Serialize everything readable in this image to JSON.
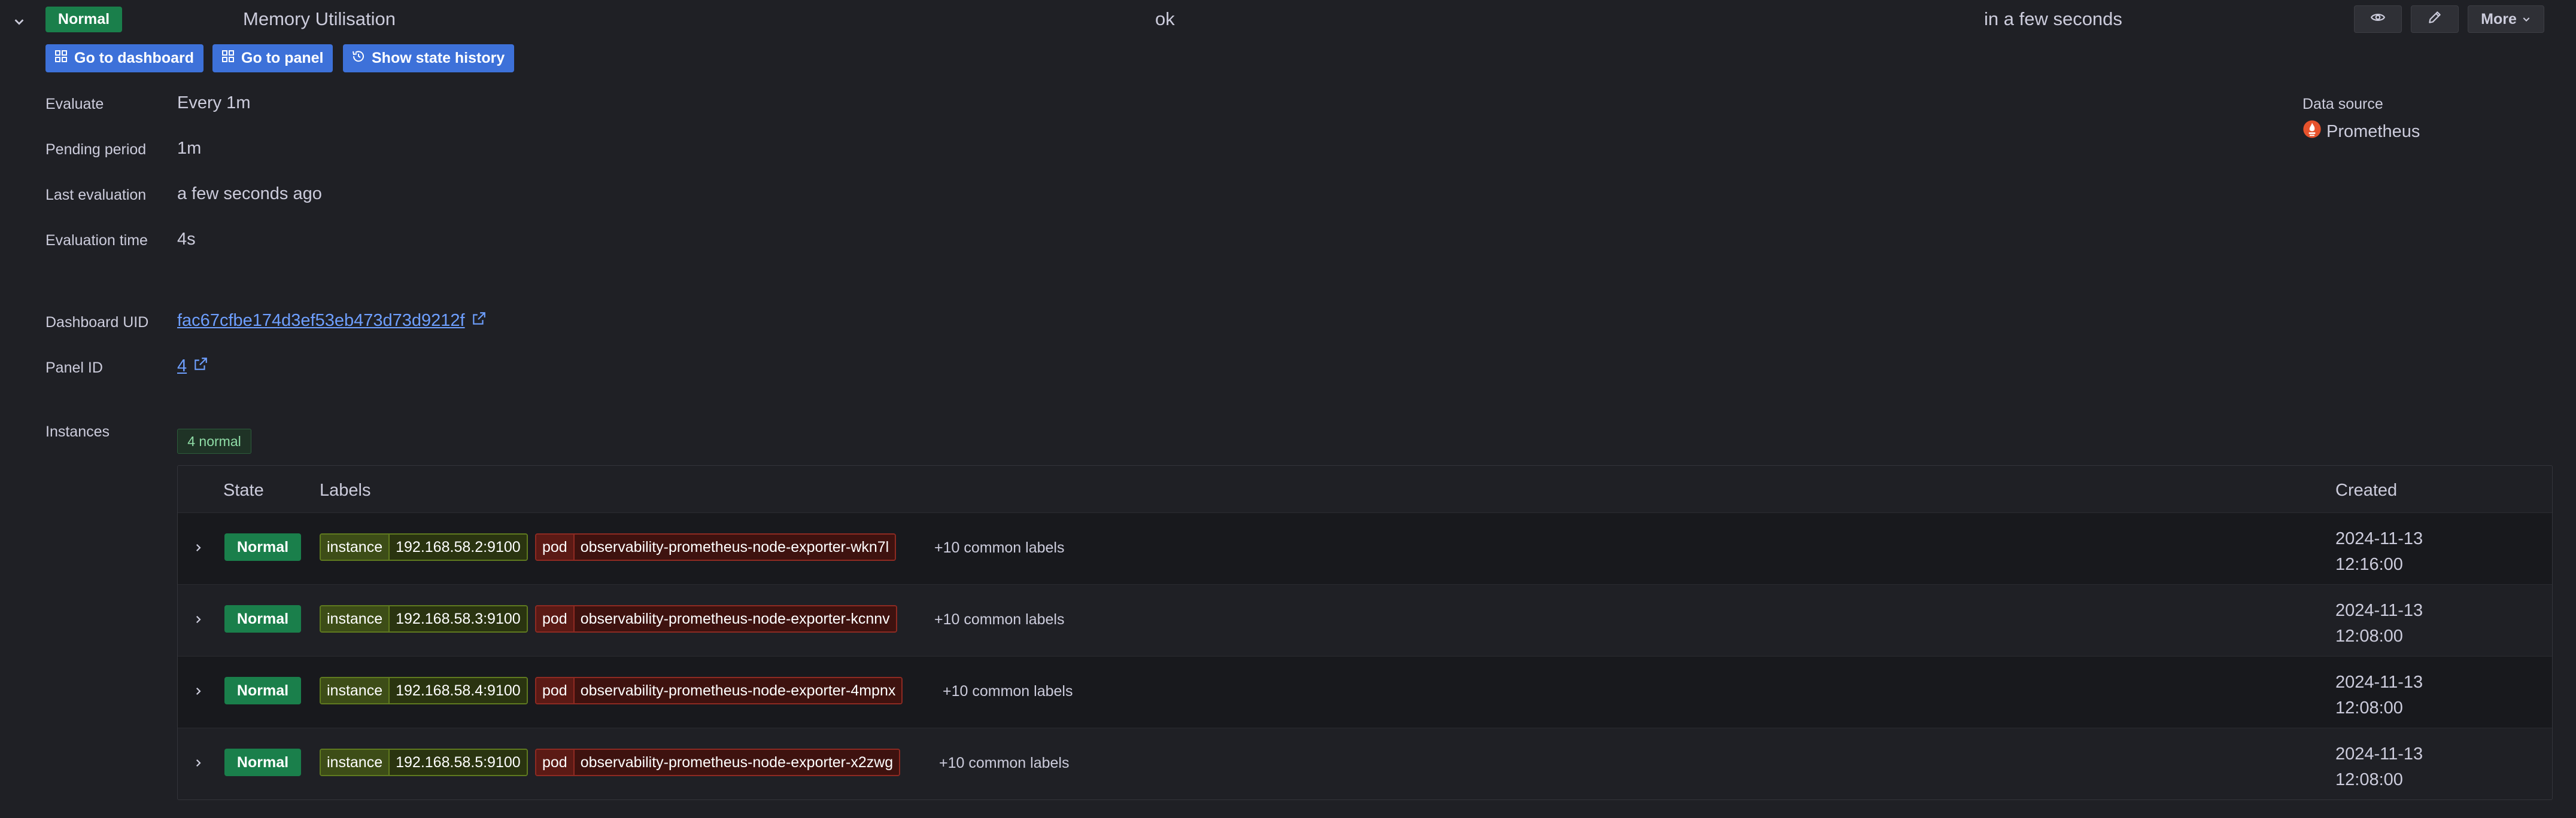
{
  "header": {
    "state": "Normal",
    "rule_name": "Memory Utilisation",
    "health": "ok",
    "next_evaluation": "in a few seconds",
    "more_label": "More"
  },
  "actions": {
    "go_to_dashboard": "Go to dashboard",
    "go_to_panel": "Go to panel",
    "show_state_history": "Show state history"
  },
  "details": {
    "evaluate_label": "Evaluate",
    "evaluate_value": "Every 1m",
    "pending_label": "Pending period",
    "pending_value": "1m",
    "last_eval_label": "Last evaluation",
    "last_eval_value": "a few seconds ago",
    "eval_time_label": "Evaluation time",
    "eval_time_value": "4s",
    "dashboard_uid_label": "Dashboard UID",
    "dashboard_uid_value": "fac67cfbe174d3ef53eb473d73d9212f",
    "panel_id_label": "Panel ID",
    "panel_id_value": "4",
    "instances_label": "Instances",
    "instances_count": "4 normal",
    "data_source_label": "Data source",
    "data_source_value": "Prometheus"
  },
  "table": {
    "columns": {
      "state": "State",
      "labels": "Labels",
      "created": "Created"
    },
    "rows": [
      {
        "state": "Normal",
        "instance_key": "instance",
        "instance_value": "192.168.58.2:9100",
        "pod_key": "pod",
        "pod_value": "observability-prometheus-node-exporter-wkn7l",
        "common": "+10 common labels",
        "created_date": "2024-11-13",
        "created_time": "12:16:00"
      },
      {
        "state": "Normal",
        "instance_key": "instance",
        "instance_value": "192.168.58.3:9100",
        "pod_key": "pod",
        "pod_value": "observability-prometheus-node-exporter-kcnnv",
        "common": "+10 common labels",
        "created_date": "2024-11-13",
        "created_time": "12:08:00"
      },
      {
        "state": "Normal",
        "instance_key": "instance",
        "instance_value": "192.168.58.4:9100",
        "pod_key": "pod",
        "pod_value": "observability-prometheus-node-exporter-4mpnx",
        "common": "+10 common labels",
        "created_date": "2024-11-13",
        "created_time": "12:08:00"
      },
      {
        "state": "Normal",
        "instance_key": "instance",
        "instance_value": "192.168.58.5:9100",
        "pod_key": "pod",
        "pod_value": "observability-prometheus-node-exporter-x2zwg",
        "common": "+10 common labels",
        "created_date": "2024-11-13",
        "created_time": "12:08:00"
      }
    ]
  },
  "colors": {
    "normal_state": "#1a7f4b",
    "primary_button": "#3d71d9",
    "link": "#6e9fff",
    "background": "#1f2025"
  }
}
